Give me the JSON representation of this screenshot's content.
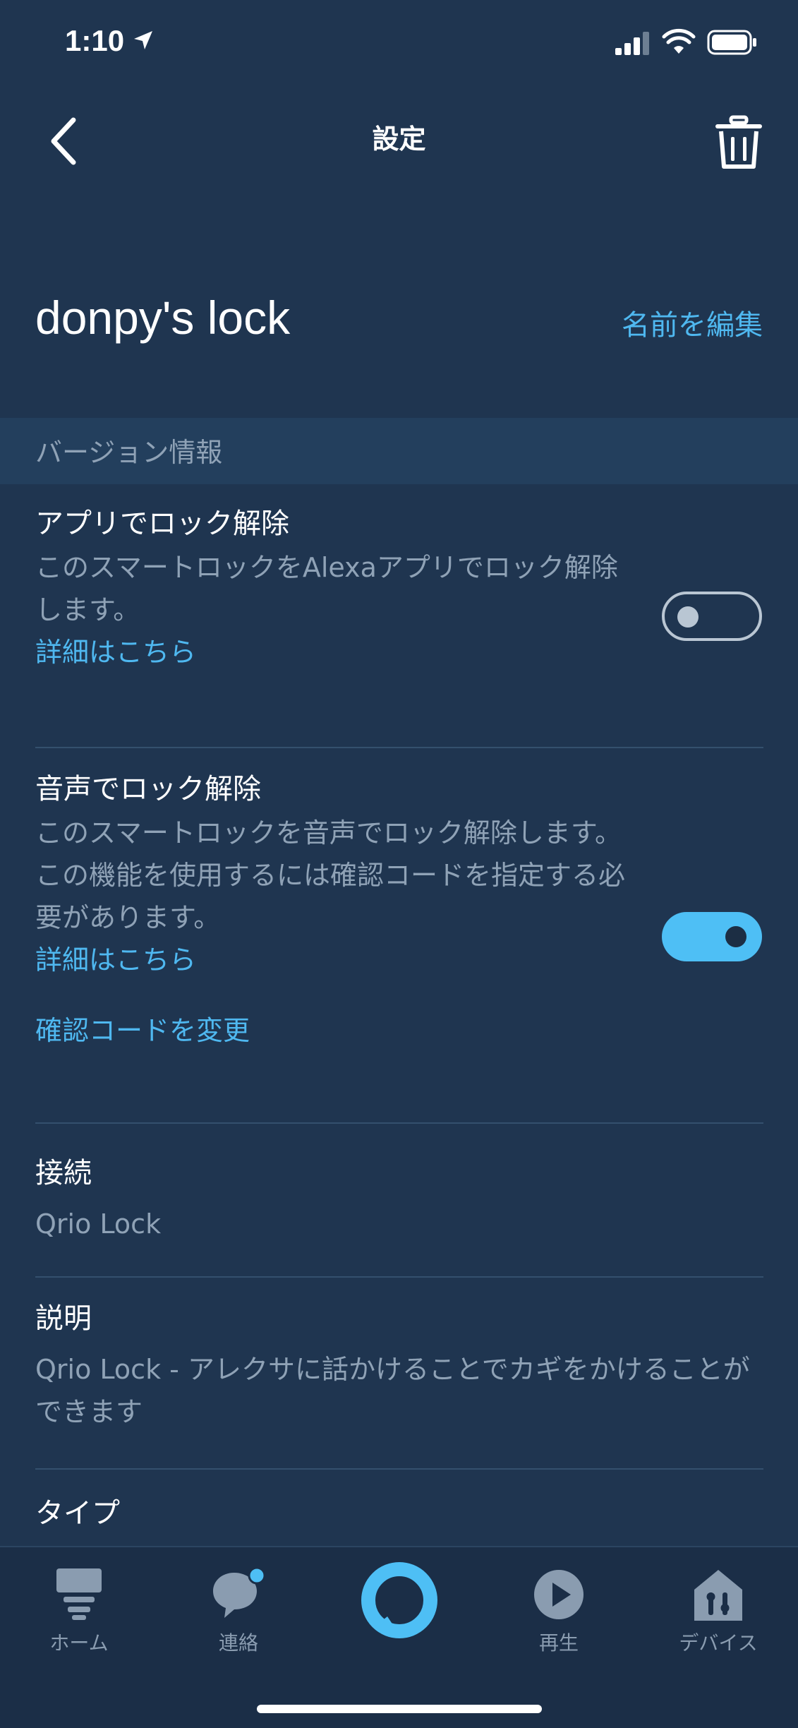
{
  "status_bar": {
    "time": "1:10"
  },
  "nav": {
    "title": "設定"
  },
  "device": {
    "name": "donpy's lock",
    "edit_label": "名前を編集"
  },
  "section": {
    "version_label": "バージョン情報"
  },
  "app_unlock": {
    "title": "アプリでロック解除",
    "description": "このスマートロックをAlexaアプリでロック解除します。",
    "link": "詳細はこちら",
    "enabled": false
  },
  "voice_unlock": {
    "title": "音声でロック解除",
    "description": "このスマートロックを音声でロック解除します。この機能を使用するには確認コードを指定する必要があります。",
    "link": "詳細はこちら",
    "change_code": "確認コードを変更",
    "enabled": true
  },
  "connection": {
    "title": "接続",
    "value": "Qrio Lock"
  },
  "description_item": {
    "title": "説明",
    "value": "Qrio Lock - アレクサに話かけることでカギをかけることができます"
  },
  "type_item": {
    "title": "タイプ"
  },
  "tabs": [
    {
      "label": "ホーム",
      "icon": "home-icon"
    },
    {
      "label": "連絡",
      "icon": "chat-bubble-icon"
    },
    {
      "label": "",
      "icon": "alexa-ring-icon"
    },
    {
      "label": "再生",
      "icon": "play-icon"
    },
    {
      "label": "デバイス",
      "icon": "devices-house-icon"
    }
  ],
  "colors": {
    "background": "#1f3550",
    "accent": "#4fb8f0",
    "toggle_on": "#4ebff5",
    "muted_text": "#8fa2b6"
  }
}
